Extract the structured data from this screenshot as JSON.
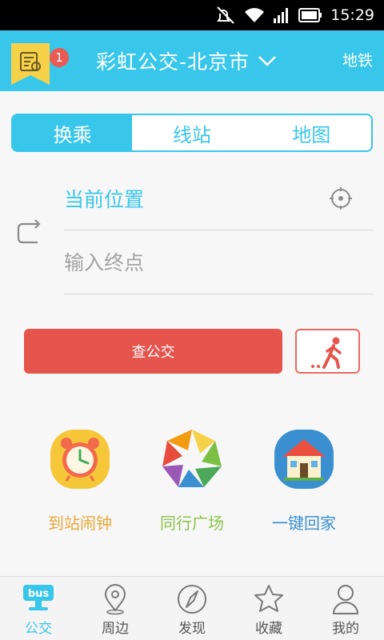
{
  "status_bar": {
    "time": "15:29"
  },
  "header": {
    "message_badge": "1",
    "title": "彩虹公交-北京市",
    "subway_label": "地铁"
  },
  "tabs": [
    {
      "label": "换乘",
      "active": true
    },
    {
      "label": "线站",
      "active": false
    },
    {
      "label": "地图",
      "active": false
    }
  ],
  "route": {
    "start_value": "当前位置",
    "end_placeholder": "输入终点"
  },
  "actions": {
    "search_label": "查公交"
  },
  "features": [
    {
      "label": "到站闹钟",
      "color": "#e9a93a"
    },
    {
      "label": "同行广场",
      "color": "#8bc34a"
    },
    {
      "label": "一键回家",
      "color": "#3a8fd0"
    }
  ],
  "bottom_nav": [
    {
      "label": "公交",
      "active": true
    },
    {
      "label": "周边",
      "active": false
    },
    {
      "label": "发现",
      "active": false
    },
    {
      "label": "收藏",
      "active": false
    },
    {
      "label": "我的",
      "active": false
    }
  ],
  "colors": {
    "primary": "#38c6ea",
    "accent_red": "#e6554d"
  }
}
